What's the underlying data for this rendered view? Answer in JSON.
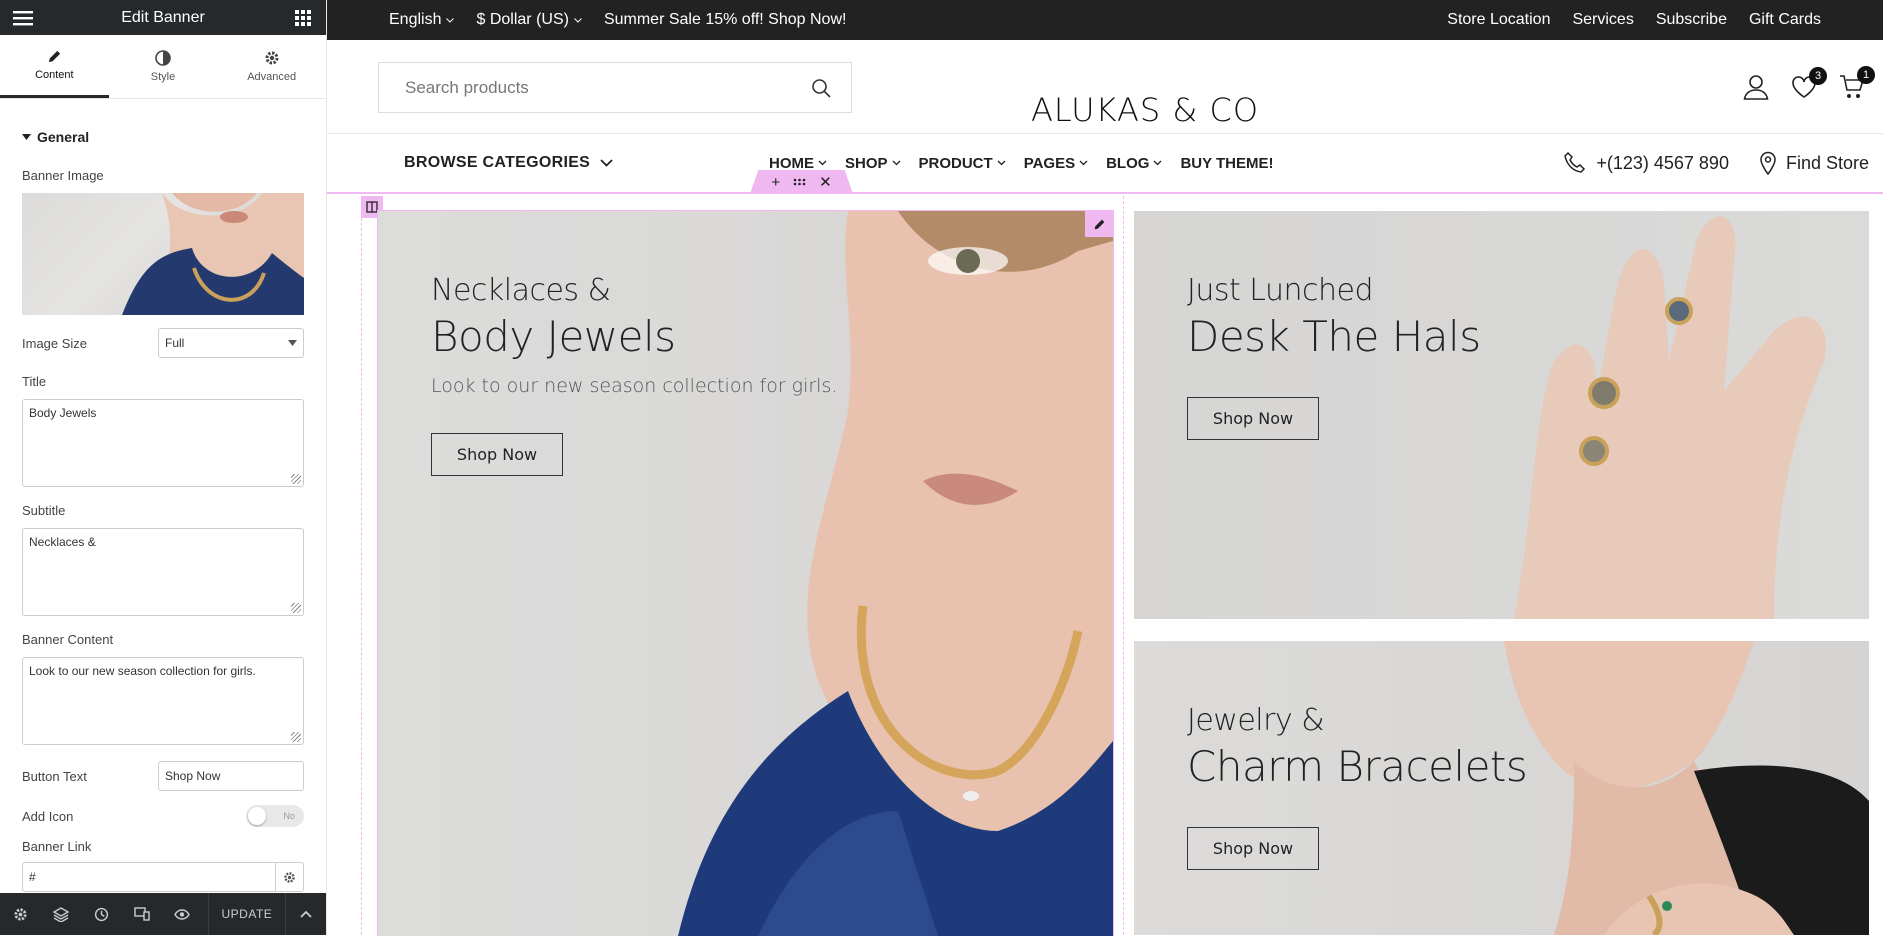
{
  "editor": {
    "title": "Edit Banner",
    "tabs": [
      {
        "label": "Content"
      },
      {
        "label": "Style"
      },
      {
        "label": "Advanced"
      }
    ],
    "section": "General",
    "fields": {
      "banner_image_label": "Banner Image",
      "image_size_label": "Image Size",
      "image_size_value": "Full",
      "title_label": "Title",
      "title_value": "Body Jewels",
      "subtitle_label": "Subtitle",
      "subtitle_value": "Necklaces &",
      "content_label": "Banner Content",
      "content_value": "Look to our new season collection for girls.",
      "button_text_label": "Button Text",
      "button_text_value": "Shop Now",
      "add_icon_label": "Add Icon",
      "add_icon_toggle": "No",
      "banner_link_label": "Banner Link",
      "banner_link_value": "#"
    },
    "update_label": "UPDATE"
  },
  "topbar": {
    "language": "English",
    "currency": "$ Dollar (US)",
    "promo": "Summer Sale 15% off! Shop Now!",
    "links": [
      "Store Location",
      "Services",
      "Subscribe",
      "Gift Cards"
    ]
  },
  "header": {
    "search_placeholder": "Search products",
    "logo": "ALUKAS & CO",
    "wishlist_count": "3",
    "cart_count": "1"
  },
  "nav": {
    "browse": "BROWSE CATEGORIES",
    "menu": [
      {
        "label": "HOME"
      },
      {
        "label": "SHOP"
      },
      {
        "label": "PRODUCT"
      },
      {
        "label": "PAGES"
      },
      {
        "label": "BLOG"
      },
      {
        "label": "BUY THEME!"
      }
    ],
    "phone": "+(123) 4567 890",
    "find_store": "Find Store"
  },
  "banners": [
    {
      "subtitle": "Necklaces &",
      "title": "Body Jewels",
      "content": "Look to our new season collection for girls.",
      "button": "Shop Now"
    },
    {
      "subtitle": "Just Lunched",
      "title": "Desk The Hals",
      "button": "Shop Now"
    },
    {
      "subtitle": "Jewelry &",
      "title": "Charm Bracelets",
      "button": "Shop Now"
    }
  ],
  "colors": {
    "editor_dark": "#26292c",
    "topbar": "#222222",
    "selection": "#f0b8f0"
  }
}
